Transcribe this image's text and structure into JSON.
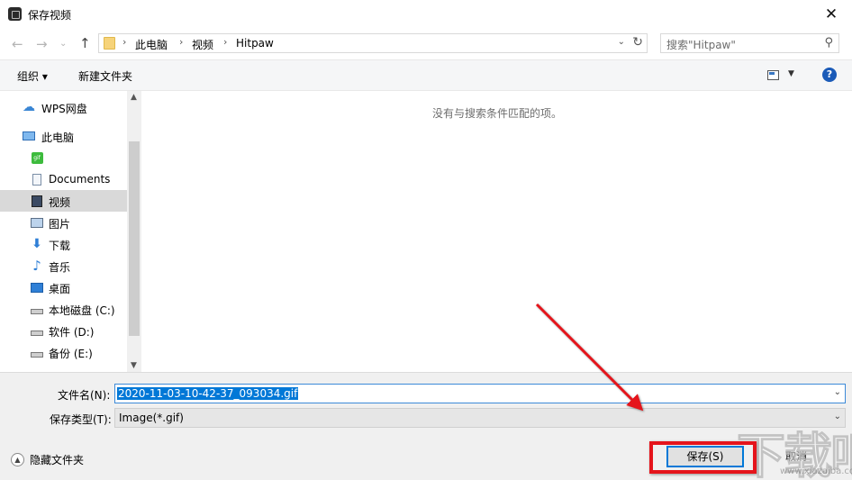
{
  "window": {
    "title": "保存视频",
    "close_label": "✕"
  },
  "nav": {
    "breadcrumbs": [
      "此电脑",
      "视频",
      "Hitpaw"
    ],
    "search_placeholder": "搜索\"Hitpaw\""
  },
  "toolbar": {
    "organize_label": "组织 ▾",
    "new_folder_label": "新建文件夹",
    "help_label": "?"
  },
  "sidebar": {
    "items": [
      {
        "label": "WPS网盘",
        "icon": "cloud-icon"
      },
      {
        "label": "此电脑",
        "icon": "computer-icon"
      },
      {
        "label": "",
        "icon": "gif-folder-icon"
      },
      {
        "label": "Documents",
        "icon": "documents-icon"
      },
      {
        "label": "视频",
        "icon": "video-icon",
        "selected": true
      },
      {
        "label": "图片",
        "icon": "pictures-icon"
      },
      {
        "label": "下载",
        "icon": "download-icon"
      },
      {
        "label": "音乐",
        "icon": "music-icon"
      },
      {
        "label": "桌面",
        "icon": "desktop-icon"
      },
      {
        "label": "本地磁盘 (C:)",
        "icon": "drive-c-icon"
      },
      {
        "label": "软件 (D:)",
        "icon": "drive-d-icon"
      },
      {
        "label": "备份 (E:)",
        "icon": "drive-e-icon"
      }
    ]
  },
  "content": {
    "empty_message": "没有与搜索条件匹配的项。"
  },
  "form": {
    "filename_label": "文件名(N):",
    "filename_value": "2020-11-03-10-42-37_093034.gif",
    "filetype_label": "保存类型(T):",
    "filetype_value": "Image(*.gif)"
  },
  "footer": {
    "hide_folders_label": "隐藏文件夹",
    "save_label": "保存(S)",
    "cancel_label": "取消"
  },
  "watermark": {
    "text": "下载吧",
    "url": "www.xiazaiba.com"
  },
  "colors": {
    "accent": "#0078d7",
    "highlight": "#e5141b",
    "selected_bg": "#d9d9d9"
  }
}
